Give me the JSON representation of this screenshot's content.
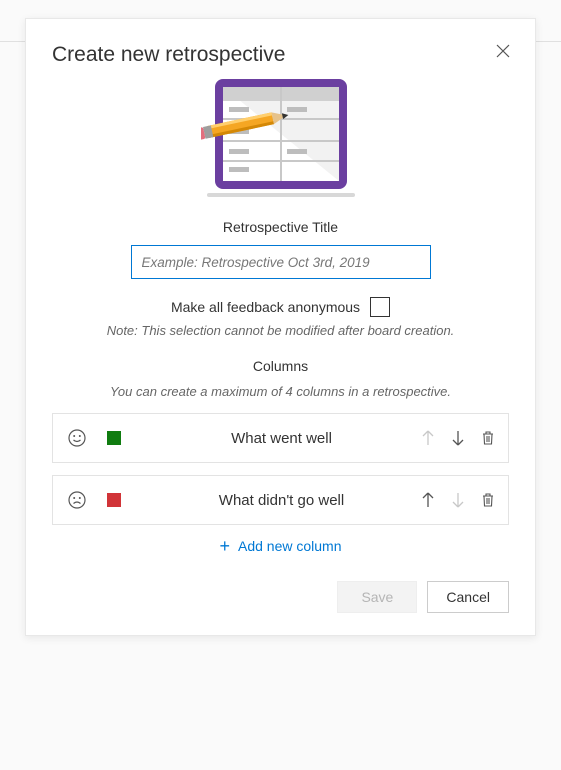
{
  "dialog": {
    "title": "Create new retrospective",
    "titleField": {
      "label": "Retrospective Title",
      "placeholder": "Example: Retrospective Oct 3rd, 2019"
    },
    "anonymous": {
      "label": "Make all feedback anonymous",
      "note": "Note: This selection cannot be modified after board creation."
    },
    "columnsSection": {
      "heading": "Columns",
      "note": "You can create a maximum of 4 columns in a retrospective."
    },
    "columns": [
      {
        "name": "What went well",
        "color": "#107c10",
        "mood": "smile",
        "upEnabled": false,
        "downEnabled": true
      },
      {
        "name": "What didn't go well",
        "color": "#d13438",
        "mood": "frown",
        "upEnabled": true,
        "downEnabled": false
      }
    ],
    "addColumn": "Add new column",
    "buttons": {
      "save": "Save",
      "cancel": "Cancel"
    }
  }
}
